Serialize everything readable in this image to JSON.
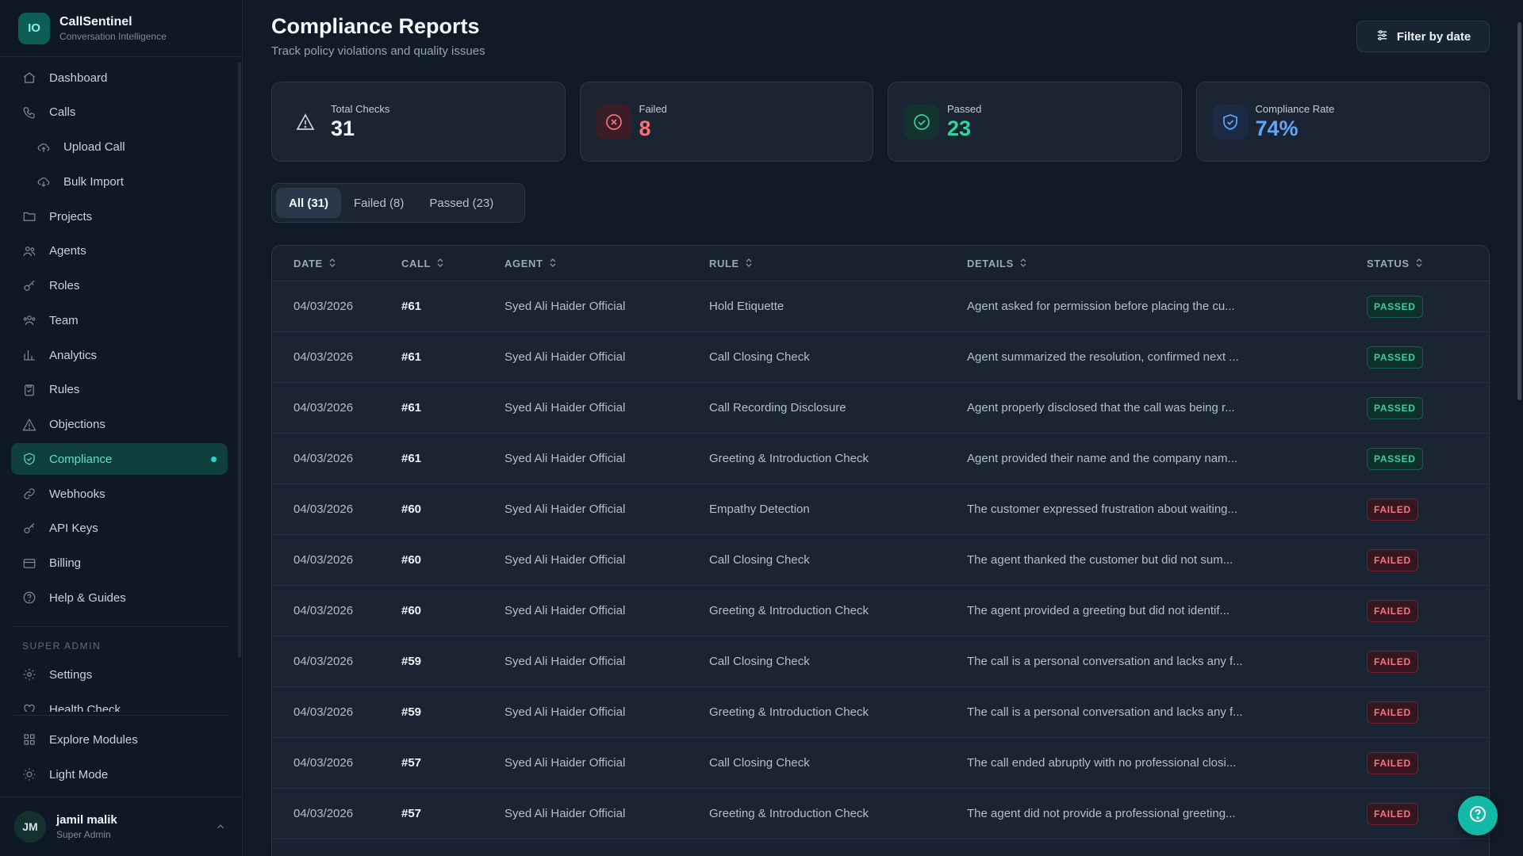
{
  "brand": {
    "initials": "IO",
    "name": "CallSentinel",
    "tagline": "Conversation Intelligence"
  },
  "nav": [
    {
      "label": "Dashboard",
      "icon": "home-icon",
      "sub": false
    },
    {
      "label": "Calls",
      "icon": "phone-icon",
      "sub": false
    },
    {
      "label": "Upload Call",
      "icon": "upload-cloud-icon",
      "sub": true
    },
    {
      "label": "Bulk Import",
      "icon": "download-cloud-icon",
      "sub": true
    },
    {
      "label": "Projects",
      "icon": "folder-icon",
      "sub": false
    },
    {
      "label": "Agents",
      "icon": "users-icon",
      "sub": false
    },
    {
      "label": "Roles",
      "icon": "key-icon",
      "sub": false
    },
    {
      "label": "Team",
      "icon": "team-icon",
      "sub": false
    },
    {
      "label": "Analytics",
      "icon": "bar-chart-icon",
      "sub": false
    },
    {
      "label": "Rules",
      "icon": "clipboard-icon",
      "sub": false
    },
    {
      "label": "Objections",
      "icon": "alert-triangle-icon",
      "sub": false
    },
    {
      "label": "Compliance",
      "icon": "shield-check-icon",
      "sub": false,
      "active": true
    },
    {
      "label": "Webhooks",
      "icon": "link-icon",
      "sub": false
    },
    {
      "label": "API Keys",
      "icon": "key-icon",
      "sub": false
    },
    {
      "label": "Billing",
      "icon": "credit-card-icon",
      "sub": false
    },
    {
      "label": "Help & Guides",
      "icon": "help-circle-icon",
      "sub": false
    }
  ],
  "admin_section": {
    "title": "SUPER ADMIN",
    "items": [
      {
        "label": "Settings",
        "icon": "gear-icon"
      },
      {
        "label": "Health Check",
        "icon": "heart-icon"
      }
    ]
  },
  "bottom_nav": [
    {
      "label": "Explore Modules",
      "icon": "grid-icon"
    },
    {
      "label": "Light Mode",
      "icon": "sun-icon"
    }
  ],
  "user": {
    "initials": "JM",
    "name": "jamil malik",
    "role": "Super Admin"
  },
  "page": {
    "title": "Compliance Reports",
    "subtitle": "Track policy violations and quality issues",
    "filter_label": "Filter by date"
  },
  "stats": [
    {
      "label": "Total Checks",
      "value": "31",
      "icon": "alert-triangle-icon",
      "color": "#f1f5f9",
      "icon_color": "#cbd5e1",
      "icon_bg": "transparent"
    },
    {
      "label": "Failed",
      "value": "8",
      "icon": "x-circle-icon",
      "color": "#f87171",
      "icon_color": "#f87171",
      "icon_bg": "#3a1d27"
    },
    {
      "label": "Passed",
      "value": "23",
      "icon": "check-circle-icon",
      "color": "#34d399",
      "icon_color": "#34d399",
      "icon_bg": "#123330"
    },
    {
      "label": "Compliance Rate",
      "value": "74%",
      "icon": "shield-check-icon",
      "color": "#60a5fa",
      "icon_color": "#60a5fa",
      "icon_bg": "#1b2a45"
    }
  ],
  "tabs": [
    {
      "label": "All (31)",
      "active": true
    },
    {
      "label": "Failed (8)",
      "active": false
    },
    {
      "label": "Passed (23)",
      "active": false
    }
  ],
  "table": {
    "columns": [
      "DATE",
      "CALL",
      "AGENT",
      "RULE",
      "DETAILS",
      "STATUS"
    ],
    "rows": [
      {
        "date": "04/03/2026",
        "call": "#61",
        "agent": "Syed Ali Haider Official",
        "rule": "Hold Etiquette",
        "details": "Agent asked for permission before placing the cu...",
        "status": "PASSED"
      },
      {
        "date": "04/03/2026",
        "call": "#61",
        "agent": "Syed Ali Haider Official",
        "rule": "Call Closing Check",
        "details": "Agent summarized the resolution, confirmed next ...",
        "status": "PASSED"
      },
      {
        "date": "04/03/2026",
        "call": "#61",
        "agent": "Syed Ali Haider Official",
        "rule": "Call Recording Disclosure",
        "details": "Agent properly disclosed that the call was being r...",
        "status": "PASSED"
      },
      {
        "date": "04/03/2026",
        "call": "#61",
        "agent": "Syed Ali Haider Official",
        "rule": "Greeting & Introduction Check",
        "details": "Agent provided their name and the company nam...",
        "status": "PASSED"
      },
      {
        "date": "04/03/2026",
        "call": "#60",
        "agent": "Syed Ali Haider Official",
        "rule": "Empathy Detection",
        "details": "The customer expressed frustration about waiting...",
        "status": "FAILED"
      },
      {
        "date": "04/03/2026",
        "call": "#60",
        "agent": "Syed Ali Haider Official",
        "rule": "Call Closing Check",
        "details": "The agent thanked the customer but did not sum...",
        "status": "FAILED"
      },
      {
        "date": "04/03/2026",
        "call": "#60",
        "agent": "Syed Ali Haider Official",
        "rule": "Greeting & Introduction Check",
        "details": "The agent provided a greeting but did not identif...",
        "status": "FAILED"
      },
      {
        "date": "04/03/2026",
        "call": "#59",
        "agent": "Syed Ali Haider Official",
        "rule": "Call Closing Check",
        "details": "The call is a personal conversation and lacks any f...",
        "status": "FAILED"
      },
      {
        "date": "04/03/2026",
        "call": "#59",
        "agent": "Syed Ali Haider Official",
        "rule": "Greeting & Introduction Check",
        "details": "The call is a personal conversation and lacks any f...",
        "status": "FAILED"
      },
      {
        "date": "04/03/2026",
        "call": "#57",
        "agent": "Syed Ali Haider Official",
        "rule": "Call Closing Check",
        "details": "The call ended abruptly with no professional closi...",
        "status": "FAILED"
      },
      {
        "date": "04/03/2026",
        "call": "#57",
        "agent": "Syed Ali Haider Official",
        "rule": "Greeting & Introduction Check",
        "details": "The agent did not provide a professional greeting...",
        "status": "FAILED"
      }
    ]
  }
}
